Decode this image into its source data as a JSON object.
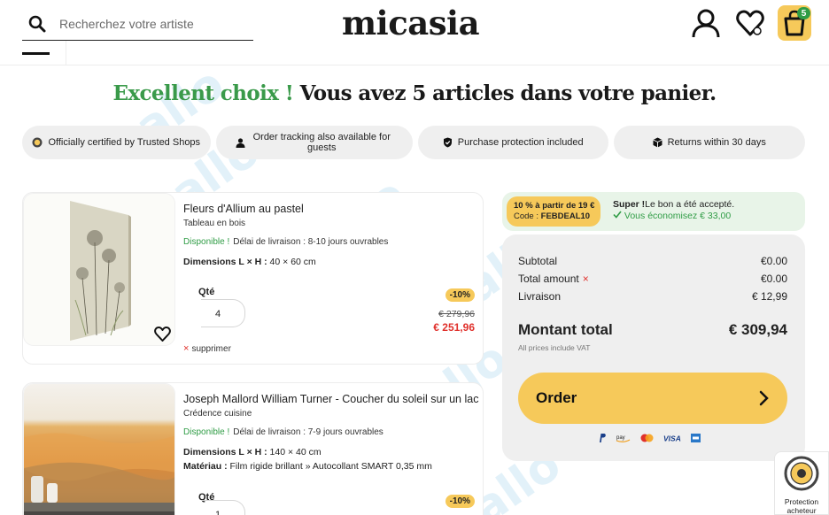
{
  "header": {
    "search_placeholder": "Recherchez votre artiste",
    "logo": "micasia",
    "cart_count": "5"
  },
  "title": {
    "green_part": "Excellent choix !",
    "rest": "Vous avez 5 articles dans votre panier."
  },
  "badges": [
    {
      "label": "Officially certified by Trusted Shops",
      "icon": "trusted-shops-icon"
    },
    {
      "label": "Order tracking also available for guests",
      "icon": "person-icon"
    },
    {
      "label": "Purchase protection included",
      "icon": "shield-check-icon"
    },
    {
      "label": "Returns within 30 days",
      "icon": "package-icon"
    }
  ],
  "products": [
    {
      "name": "Fleurs d'Allium au pastel",
      "type": "Tableau en bois",
      "availability": "Disponible !",
      "delivery": "Délai de livraison : 8-10 jours ouvrables",
      "dimensions_label": "Dimensions L × H :",
      "dimensions": "40 × 60 cm",
      "qty_label": "Qté",
      "qty": "4",
      "remove": "supprimer",
      "discount": "-10%",
      "old_price": "€ 279,96",
      "new_price": "€ 251,96"
    },
    {
      "name": "Joseph Mallord William Turner - Coucher du soleil sur un lac",
      "type": "Crédence cuisine",
      "availability": "Disponible !",
      "delivery": "Délai de livraison : 7-9 jours ouvrables",
      "dimensions_label": "Dimensions L × H :",
      "dimensions": "140 × 40 cm",
      "material_label": "Matériau :",
      "material": "Film rigide brillant » Autocollant SMART 0,35 mm",
      "qty_label": "Qté",
      "qty": "1",
      "discount": "-10%"
    }
  ],
  "promo": {
    "line1": "10 % à partir de 19 €",
    "code_label": "Code :",
    "code": "FEBDEAL10",
    "msg_bold": "Super !",
    "msg": "Le bon a été accepté.",
    "saved": "Vous économisez € 33,00"
  },
  "summary": {
    "subtotal_label": "Subtotal",
    "subtotal": "€0.00",
    "total_amount_label": "Total amount",
    "total_amount": "€0.00",
    "shipping_label": "Livraison",
    "shipping": "€ 12,99",
    "total_label": "Montant total",
    "total": "€ 309,94",
    "vat_note": "All prices include VAT",
    "order_label": "Order",
    "payment_methods": [
      "PayPal",
      "Amazon Pay",
      "Mastercard",
      "VISA",
      "American Express"
    ]
  },
  "trusted_shops": {
    "label": "Protection acheteur"
  },
  "colors": {
    "accent_yellow": "#f6c95a",
    "green": "#3a9a4a",
    "price_red": "#e0312c"
  }
}
